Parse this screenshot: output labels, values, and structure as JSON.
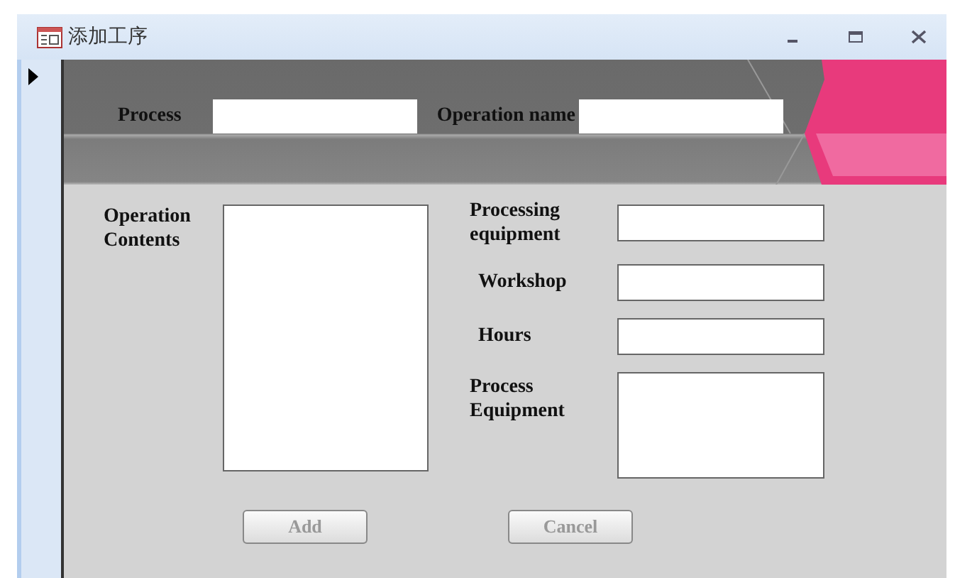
{
  "window": {
    "title": "添加工序"
  },
  "header": {
    "fields": [
      {
        "label": "Process"
      },
      {
        "label": "Operation name"
      }
    ]
  },
  "contents": {
    "label": "Operation Contents"
  },
  "fields": [
    {
      "label": "Processing equipment",
      "kind": "text"
    },
    {
      "label": "Workshop",
      "kind": "text"
    },
    {
      "label": "Hours",
      "kind": "text"
    },
    {
      "label": "Process Equipment",
      "kind": "textarea"
    }
  ],
  "buttons": [
    {
      "label": "Add",
      "disabled": true
    },
    {
      "label": "Cancel",
      "disabled": true
    }
  ]
}
